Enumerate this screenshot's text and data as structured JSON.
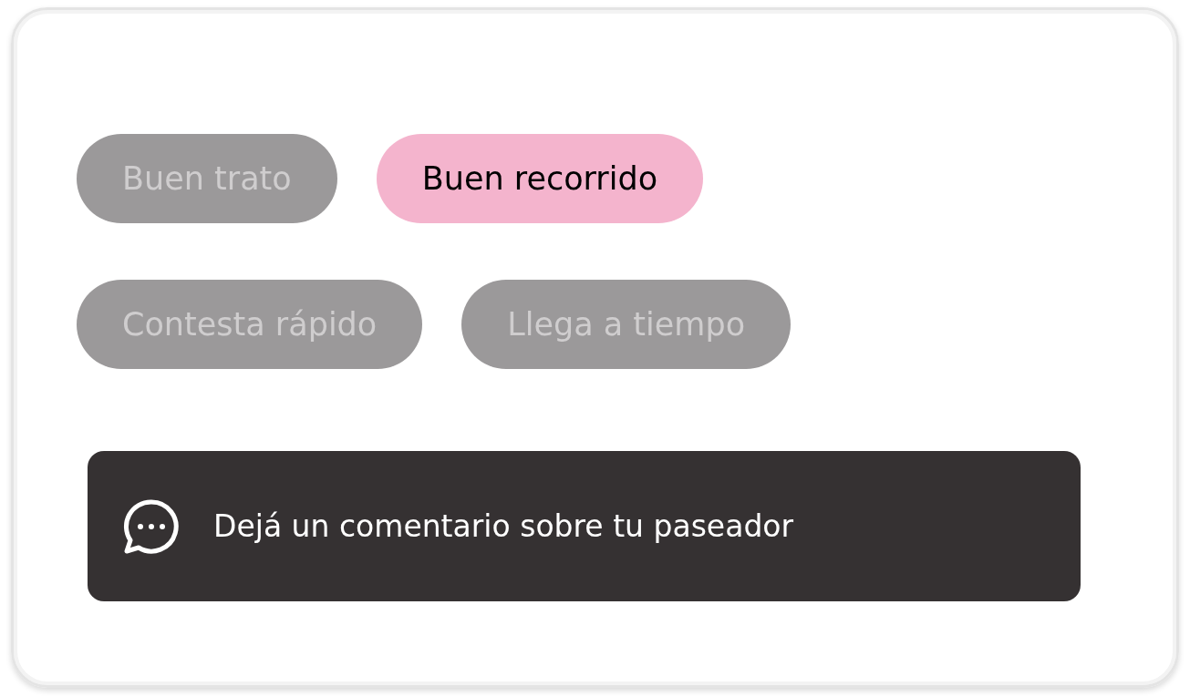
{
  "tags": [
    {
      "label": "Buen trato",
      "selected": false
    },
    {
      "label": "Buen recorrido",
      "selected": true
    },
    {
      "label": "Contesta rápido",
      "selected": false
    },
    {
      "label": "Llega a tiempo",
      "selected": false
    }
  ],
  "comment_button": {
    "label": "Dejá un comentario sobre tu paseador"
  }
}
